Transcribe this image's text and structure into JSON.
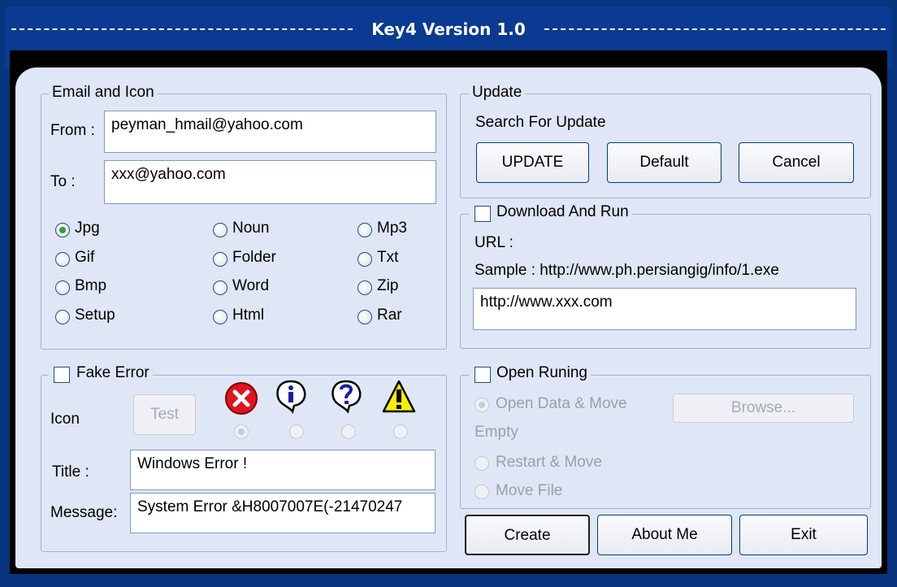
{
  "window": {
    "title": "Key4 Version 1.0"
  },
  "email_icon": {
    "legend": "Email and Icon",
    "from_label": "From :",
    "from_value": "peyman_hmail@yahoo.com",
    "to_label": "To :",
    "to_value": "xxx@yahoo.com",
    "icon_options": [
      {
        "label": "Jpg",
        "selected": true
      },
      {
        "label": "Gif",
        "selected": false
      },
      {
        "label": "Bmp",
        "selected": false
      },
      {
        "label": "Setup",
        "selected": false
      },
      {
        "label": "Noun",
        "selected": false
      },
      {
        "label": "Folder",
        "selected": false
      },
      {
        "label": "Word",
        "selected": false
      },
      {
        "label": "Html",
        "selected": false
      },
      {
        "label": "Mp3",
        "selected": false
      },
      {
        "label": "Txt",
        "selected": false
      },
      {
        "label": "Zip",
        "selected": false
      },
      {
        "label": "Rar",
        "selected": false
      }
    ]
  },
  "update": {
    "legend": "Update",
    "text": "Search For Update",
    "update_button": "UPDATE",
    "default_button": "Default",
    "cancel_button": "Cancel"
  },
  "download": {
    "legend": "Download And  Run",
    "checked": false,
    "url_label": "URL :",
    "sample": "Sample : http://www.ph.persiangig/info/1.exe",
    "url_value": "http://www.xxx.com"
  },
  "fake_error": {
    "legend": "Fake Error",
    "checked": false,
    "icon_label": "Icon",
    "test_button": "Test",
    "icons": [
      "error-icon",
      "info-icon",
      "question-icon",
      "warning-icon"
    ],
    "title_label": "Title :",
    "title_value": "Windows Error !",
    "message_label": "Message:",
    "message_value": "System Error &H8007007E(-21470247"
  },
  "open_running": {
    "legend": "Open Runing",
    "checked": false,
    "option_open_data": "Open Data & Move",
    "browse_button": "Browse...",
    "empty_text": "Empty",
    "option_restart": "Restart & Move",
    "option_move_file": "Move File"
  },
  "actions": {
    "create": "Create",
    "about": "About Me",
    "exit": "Exit"
  },
  "colors": {
    "titlebar": "#0a3a92",
    "client": "#dfe6f5",
    "button_border": "#003c74"
  }
}
